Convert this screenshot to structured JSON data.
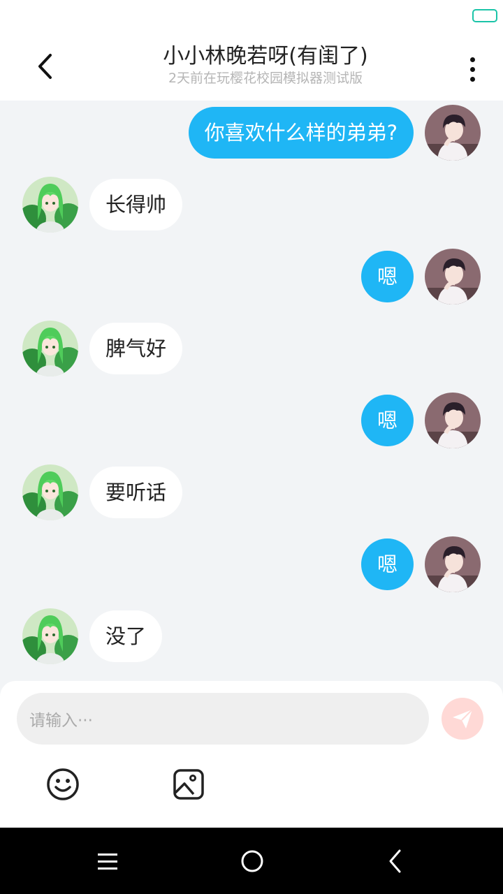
{
  "header": {
    "title": "小小林晚若呀(有闺了)",
    "subtitle": "2天前在玩樱花校园模拟器测试版"
  },
  "messages": [
    {
      "side": "right",
      "text": "你喜欢什么样的弟弟?"
    },
    {
      "side": "left",
      "text": "长得帅"
    },
    {
      "side": "right",
      "text": "嗯"
    },
    {
      "side": "left",
      "text": "脾气好"
    },
    {
      "side": "right",
      "text": "嗯"
    },
    {
      "side": "left",
      "text": "要听话"
    },
    {
      "side": "right",
      "text": "嗯"
    },
    {
      "side": "left",
      "text": "没了"
    }
  ],
  "input": {
    "placeholder": "请输入···"
  },
  "icons": {
    "back": "chevron-left-icon",
    "more": "more-vertical-icon",
    "send": "send-icon",
    "emoji": "smiley-icon",
    "image": "image-icon",
    "nav_menu": "menu-icon",
    "nav_home": "home-circle-icon",
    "nav_back": "back-arrow-icon"
  },
  "colors": {
    "accent": "#1fb6f5",
    "send_button": "#ffd9d6",
    "battery": "#1bc4a8",
    "background": "#f2f4f6"
  }
}
